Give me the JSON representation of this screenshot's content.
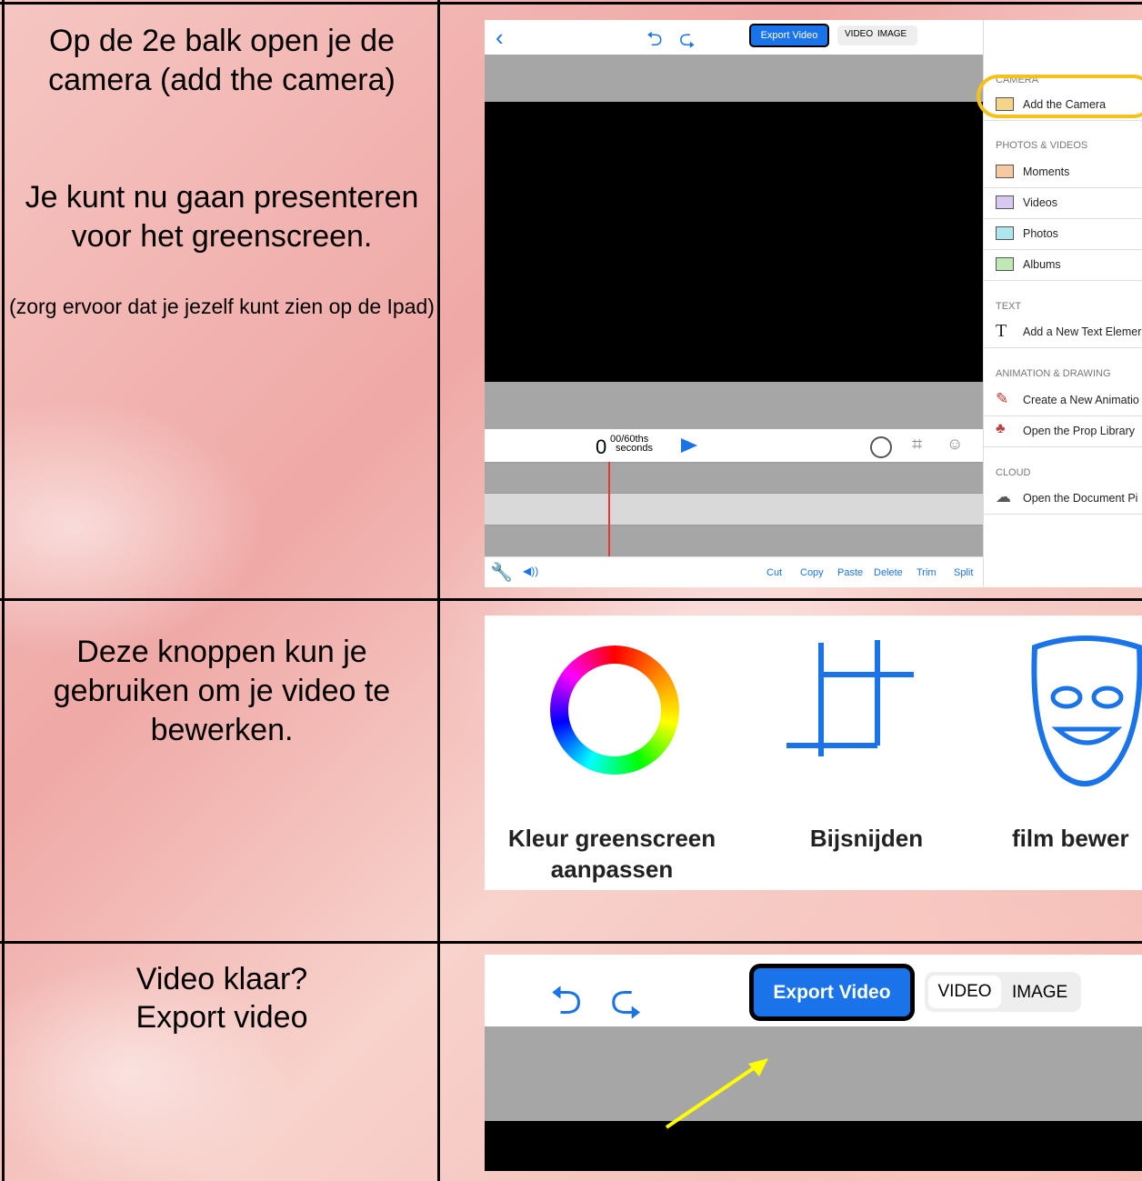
{
  "row1": {
    "instruction": "Op de 2e balk open je de camera (add the camera)",
    "line2": "Je kunt nu gaan presenteren voor het greenscreen.",
    "note": "(zorg ervoor dat je jezelf kunt zien op de Ipad)"
  },
  "row2": {
    "instruction": "Deze knoppen kun je gebruiken om je video te bewerken."
  },
  "row3": {
    "line1": "Video klaar?",
    "line2": "Export video"
  },
  "app": {
    "export_label": "Export Video",
    "video_label": "VIDEO",
    "image_label": "IMAGE",
    "time_value": "0",
    "time_fraction": "00/60ths",
    "time_unit": "seconds",
    "edit_actions": [
      "Cut",
      "Copy",
      "Paste",
      "Delete",
      "Trim",
      "Split"
    ],
    "sections": {
      "camera": "CAMERA",
      "photos": "PHOTOS & VIDEOS",
      "text": "TEXT",
      "animation": "ANIMATION & DRAWING",
      "cloud": "CLOUD"
    },
    "items": {
      "camera": "Add the Camera",
      "moments": "Moments",
      "videos": "Videos",
      "photos": "Photos",
      "albums": "Albums",
      "text": "Add a New Text Elemer",
      "animation": "Create a New Animatio",
      "props": "Open the Prop Library",
      "document": "Open the Document Pi"
    }
  },
  "tools": {
    "color": "Kleur greenscreen aanpassen",
    "crop": "Bijsnijden",
    "film": "film bewer"
  },
  "colors": {
    "accent": "#1a73e8",
    "highlight": "#f4c21b",
    "arrow": "#ffff00"
  }
}
